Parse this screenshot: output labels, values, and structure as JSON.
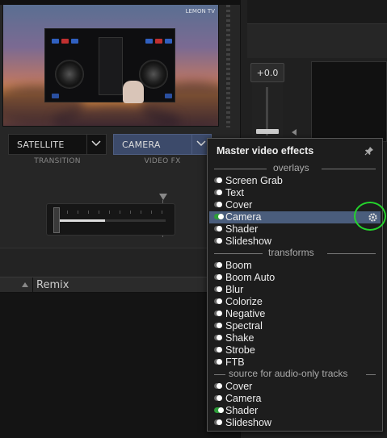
{
  "preview": {
    "logo_text": "LEMON TV"
  },
  "transition": {
    "value": "SATELLITE",
    "caption": "TRANSITION"
  },
  "video_fx": {
    "value": "CAMERA",
    "caption": "VIDEO FX"
  },
  "gain": {
    "value": "+0.0"
  },
  "remix": {
    "label": "Remix"
  },
  "popup": {
    "title": "Master video effects",
    "sections": {
      "overlays": "overlays",
      "transforms": "transforms",
      "audio_only": "source for audio-only tracks"
    },
    "overlays": [
      {
        "label": "Screen Grab",
        "on": false
      },
      {
        "label": "Text",
        "on": false
      },
      {
        "label": "Cover",
        "on": false
      },
      {
        "label": "Camera",
        "on": true,
        "selected": true
      },
      {
        "label": "Shader",
        "on": false
      },
      {
        "label": "Slideshow",
        "on": false
      }
    ],
    "transforms": [
      {
        "label": "Boom",
        "on": false
      },
      {
        "label": "Boom Auto",
        "on": false
      },
      {
        "label": "Blur",
        "on": false
      },
      {
        "label": "Colorize",
        "on": false
      },
      {
        "label": "Negative",
        "on": false
      },
      {
        "label": "Spectral",
        "on": false
      },
      {
        "label": "Shake",
        "on": false
      },
      {
        "label": "Strobe",
        "on": false
      },
      {
        "label": "FTB",
        "on": false
      }
    ],
    "audio_only": [
      {
        "label": "Cover",
        "on": false
      },
      {
        "label": "Camera",
        "on": false
      },
      {
        "label": "Shader",
        "on": true
      },
      {
        "label": "Slideshow",
        "on": false
      }
    ]
  },
  "colors": {
    "accent_green": "#24d42c",
    "selection": "#4a5d7c",
    "toggle_on": "#2e9e3a"
  }
}
